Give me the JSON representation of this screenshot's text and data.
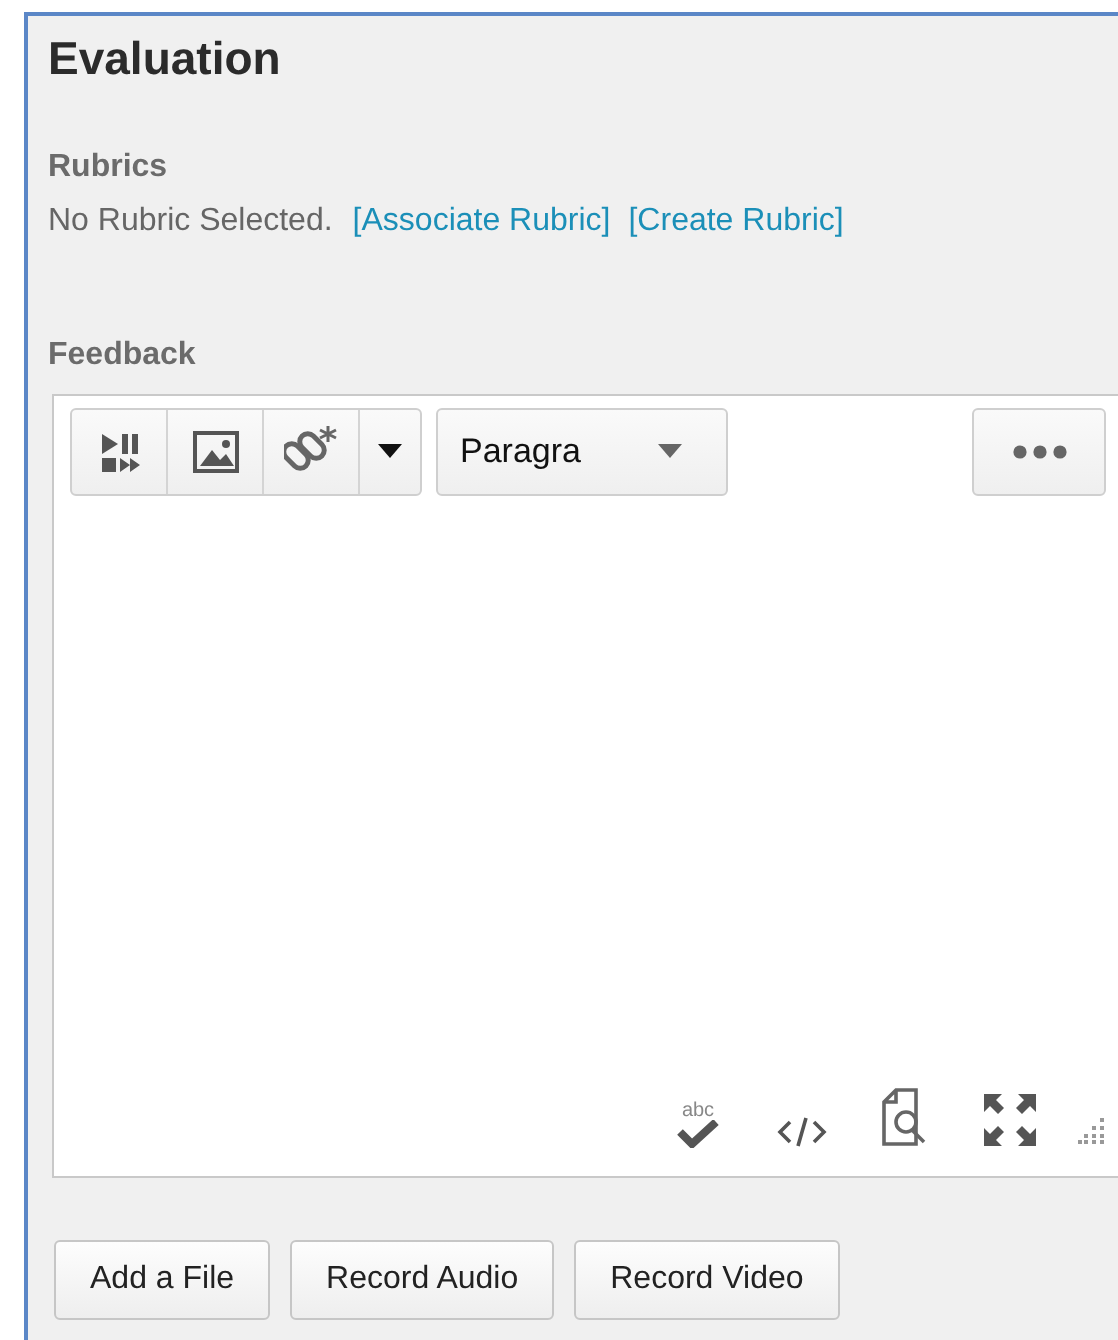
{
  "panel": {
    "title": "Evaluation"
  },
  "rubrics": {
    "heading": "Rubrics",
    "status": "No Rubric Selected.",
    "links": [
      "[Associate Rubric]",
      "[Create Rubric]"
    ]
  },
  "feedback": {
    "heading": "Feedback",
    "format": "Paragra",
    "spellcheck_label": "abc"
  },
  "buttons": [
    "Add a File",
    "Record Audio",
    "Record Video"
  ]
}
